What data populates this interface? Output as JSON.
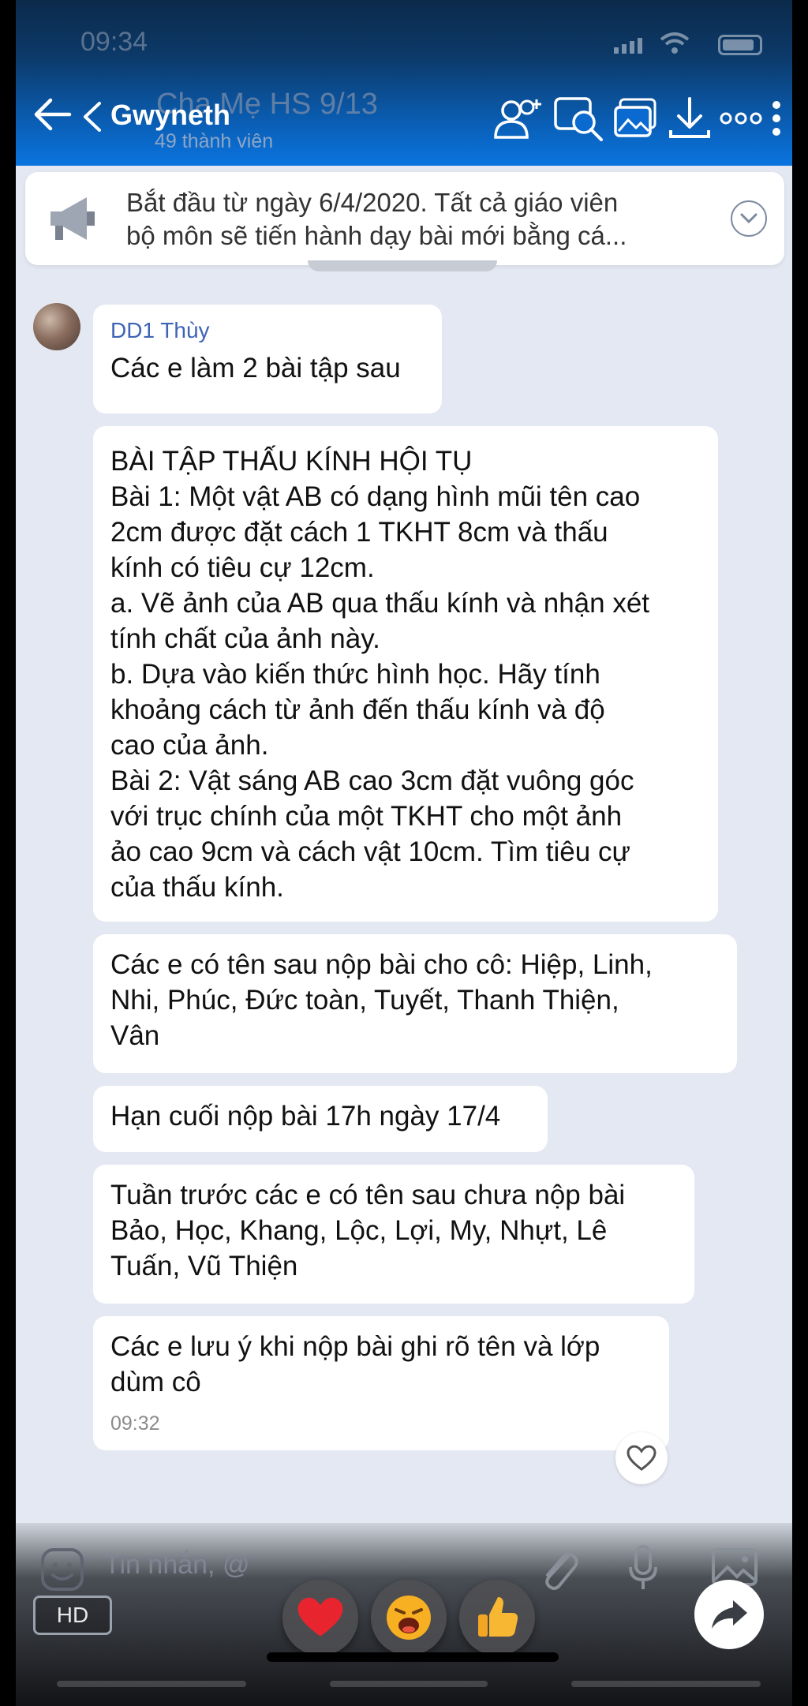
{
  "status_bar": {
    "time": "09:34"
  },
  "header": {
    "group_title": "Cha Mẹ HS 9/13",
    "contact_name": "Gwyneth",
    "member_count": "49 thành viên"
  },
  "pinned": {
    "line1": "Bắt đầu từ ngày 6/4/2020. Tất cả giáo viên",
    "line2": "bộ môn sẽ tiến hành dạy bài mới bằng cá..."
  },
  "messages": [
    {
      "sender": "DD1 Thùy",
      "lines": [
        "Các e làm 2 bài tập sau"
      ]
    },
    {
      "lines": [
        "BÀI TẬP THẤU KÍNH HỘI TỤ",
        "Bài 1: Một vật AB có dạng hình mũi tên cao",
        "2cm được đặt cách 1 TKHT 8cm và thấu",
        "kính có tiêu cự 12cm.",
        "a. Vẽ ảnh của AB qua thấu kính và nhận xét",
        "tính chất của ảnh này.",
        "b. Dựa vào kiến thức hình học. Hãy tính",
        "khoảng cách từ ảnh đến thấu kính và độ",
        "cao của ảnh.",
        "Bài 2: Vật sáng AB cao 3cm đặt vuông góc",
        "với trục chính của một TKHT cho một ảnh",
        "ảo cao 9cm và cách vật 10cm. Tìm tiêu cự",
        "của thấu kính."
      ]
    },
    {
      "lines": [
        "Các e có tên sau nộp bài cho cô: Hiệp, Linh,",
        "Nhi, Phúc, Đức toàn, Tuyết, Thanh Thiện,",
        "Vân"
      ]
    },
    {
      "lines": [
        "Hạn cuối nộp bài 17h ngày 17/4"
      ]
    },
    {
      "lines": [
        "Tuần trước các e có tên sau chưa nộp bài",
        "Bảo, Học, Khang, Lộc, Lợi, My, Nhựt, Lê",
        "Tuấn, Vũ Thiện"
      ]
    },
    {
      "lines": [
        "Các e lưu ý khi nộp bài ghi rõ tên và lớp",
        "dùm cô"
      ],
      "time": "09:32"
    }
  ],
  "composer": {
    "placeholder": "Tin nhắn, @",
    "hd_label": "HD"
  },
  "colors": {
    "header": "#0a5fb6",
    "sender": "#3f63b5",
    "background": "#e4e8f2"
  }
}
